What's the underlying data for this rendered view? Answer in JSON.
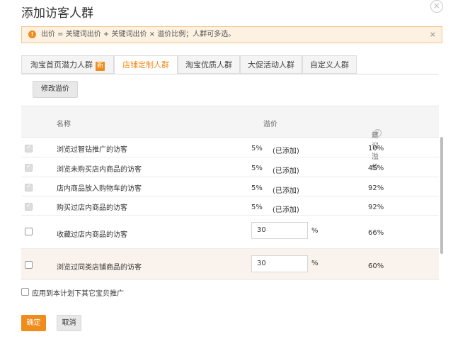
{
  "dialog": {
    "title": "添加访客人群",
    "close": "×"
  },
  "notice": {
    "icon": "!",
    "text": "出价 = 关键词出价 + 关键词出价 × 溢价比例；人群可多选。",
    "close": "×"
  },
  "tabs": [
    {
      "label": "淘宝首页潜力人群",
      "badge": "新"
    },
    {
      "label": "店铺定制人群"
    },
    {
      "label": "淘宝优质人群"
    },
    {
      "label": "大促活动人群"
    },
    {
      "label": "自定义人群"
    }
  ],
  "toolbar": {
    "modify_label": "修改溢价"
  },
  "table": {
    "headers": {
      "name": "名称",
      "premium": "溢价",
      "suggest": "建议溢价",
      "help": "?"
    },
    "rows": [
      {
        "name": "浏览过智钻推广的访客",
        "premium": "5%",
        "status": "(已添加)",
        "suggest": "10%",
        "added": true
      },
      {
        "name": "浏览未购买店内商品的访客",
        "premium": "5%",
        "status": "(已添加)",
        "suggest": "45%",
        "added": true
      },
      {
        "name": "店内商品放入购物车的访客",
        "premium": "5%",
        "status": "(已添加)",
        "suggest": "92%",
        "added": true
      },
      {
        "name": "购买过店内商品的访客",
        "premium": "5%",
        "status": "(已添加)",
        "suggest": "92%",
        "added": true
      },
      {
        "name": "收藏过店内商品的访客",
        "input": "30",
        "unit": "%",
        "suggest": "66%",
        "added": false
      },
      {
        "name": "浏览过同类店铺商品的访客",
        "input": "30",
        "unit": "%",
        "suggest": "60%",
        "added": false
      }
    ]
  },
  "apply": {
    "label": "应用到本计划下其它宝贝推广"
  },
  "footer": {
    "ok_label": "确定",
    "cancel_label": "取消"
  },
  "colors": {
    "accent": "#f08c1c",
    "notice_bg": "#fdf1e1",
    "highlight_row": "#faf2ec"
  }
}
